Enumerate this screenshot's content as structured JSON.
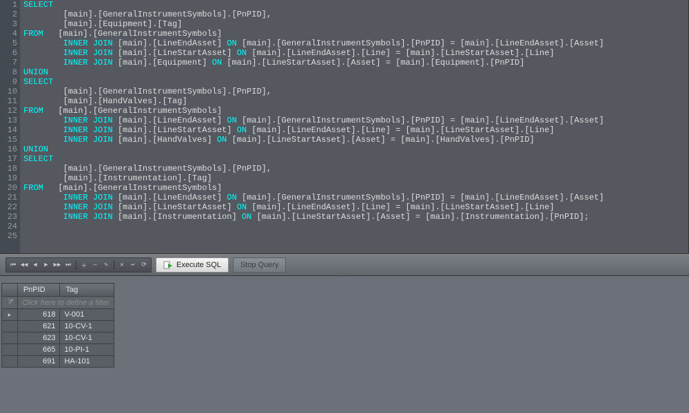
{
  "code_lines": [
    [
      {
        "t": "SELECT",
        "k": 1
      }
    ],
    [
      {
        "t": "        [main].[GeneralInstrumentSymbols].[PnPID],",
        "k": 0
      }
    ],
    [
      {
        "t": "        [main].[Equipment].[Tag]",
        "k": 0
      }
    ],
    [
      {
        "t": "FROM",
        "k": 1
      },
      {
        "t": "   [main].[GeneralInstrumentSymbols]",
        "k": 0
      }
    ],
    [
      {
        "t": "        ",
        "k": 0
      },
      {
        "t": "INNER JOIN",
        "k": 1
      },
      {
        "t": " [main].[LineEndAsset] ",
        "k": 0
      },
      {
        "t": "ON",
        "k": 1
      },
      {
        "t": " [main].[GeneralInstrumentSymbols].[PnPID] = [main].[LineEndAsset].[Asset]",
        "k": 0
      }
    ],
    [
      {
        "t": "        ",
        "k": 0
      },
      {
        "t": "INNER JOIN",
        "k": 1
      },
      {
        "t": " [main].[LineStartAsset] ",
        "k": 0
      },
      {
        "t": "ON",
        "k": 1
      },
      {
        "t": " [main].[LineEndAsset].[Line] = [main].[LineStartAsset].[Line]",
        "k": 0
      }
    ],
    [
      {
        "t": "        ",
        "k": 0
      },
      {
        "t": "INNER JOIN",
        "k": 1
      },
      {
        "t": " [main].[Equipment] ",
        "k": 0
      },
      {
        "t": "ON",
        "k": 1
      },
      {
        "t": " [main].[LineStartAsset].[Asset] = [main].[Equipment].[PnPID]",
        "k": 0
      }
    ],
    [
      {
        "t": "UNION",
        "k": 1
      }
    ],
    [
      {
        "t": "SELECT",
        "k": 1
      }
    ],
    [
      {
        "t": "        [main].[GeneralInstrumentSymbols].[PnPID],",
        "k": 0
      }
    ],
    [
      {
        "t": "        [main].[HandValves].[Tag]",
        "k": 0
      }
    ],
    [
      {
        "t": "FROM",
        "k": 1
      },
      {
        "t": "   [main].[GeneralInstrumentSymbols]",
        "k": 0
      }
    ],
    [
      {
        "t": "        ",
        "k": 0
      },
      {
        "t": "INNER JOIN",
        "k": 1
      },
      {
        "t": " [main].[LineEndAsset] ",
        "k": 0
      },
      {
        "t": "ON",
        "k": 1
      },
      {
        "t": " [main].[GeneralInstrumentSymbols].[PnPID] = [main].[LineEndAsset].[Asset]",
        "k": 0
      }
    ],
    [
      {
        "t": "        ",
        "k": 0
      },
      {
        "t": "INNER JOIN",
        "k": 1
      },
      {
        "t": " [main].[LineStartAsset] ",
        "k": 0
      },
      {
        "t": "ON",
        "k": 1
      },
      {
        "t": " [main].[LineEndAsset].[Line] = [main].[LineStartAsset].[Line]",
        "k": 0
      }
    ],
    [
      {
        "t": "        ",
        "k": 0
      },
      {
        "t": "INNER JOIN",
        "k": 1
      },
      {
        "t": " [main].[HandValves] ",
        "k": 0
      },
      {
        "t": "ON",
        "k": 1
      },
      {
        "t": " [main].[LineStartAsset].[Asset] = [main].[HandValves].[PnPID]",
        "k": 0
      }
    ],
    [
      {
        "t": "UNION",
        "k": 1
      }
    ],
    [
      {
        "t": "SELECT",
        "k": 1
      }
    ],
    [
      {
        "t": "        [main].[GeneralInstrumentSymbols].[PnPID],",
        "k": 0
      }
    ],
    [
      {
        "t": "        [main].[Instrumentation].[Tag]",
        "k": 0
      }
    ],
    [
      {
        "t": "FROM",
        "k": 1
      },
      {
        "t": "   [main].[GeneralInstrumentSymbols]",
        "k": 0
      }
    ],
    [
      {
        "t": "        ",
        "k": 0
      },
      {
        "t": "INNER JOIN",
        "k": 1
      },
      {
        "t": " [main].[LineEndAsset] ",
        "k": 0
      },
      {
        "t": "ON",
        "k": 1
      },
      {
        "t": " [main].[GeneralInstrumentSymbols].[PnPID] = [main].[LineEndAsset].[Asset]",
        "k": 0
      }
    ],
    [
      {
        "t": "        ",
        "k": 0
      },
      {
        "t": "INNER JOIN",
        "k": 1
      },
      {
        "t": " [main].[LineStartAsset] ",
        "k": 0
      },
      {
        "t": "ON",
        "k": 1
      },
      {
        "t": " [main].[LineEndAsset].[Line] = [main].[LineStartAsset].[Line]",
        "k": 0
      }
    ],
    [
      {
        "t": "        ",
        "k": 0
      },
      {
        "t": "INNER JOIN",
        "k": 1
      },
      {
        "t": " [main].[Instrumentation] ",
        "k": 0
      },
      {
        "t": "ON",
        "k": 1
      },
      {
        "t": " [main].[LineStartAsset].[Asset] = [main].[Instrumentation].[PnPID];",
        "k": 0
      }
    ],
    [
      {
        "t": "",
        "k": 0
      }
    ],
    [
      {
        "t": "",
        "k": 0
      }
    ]
  ],
  "buttons": {
    "execute": "Execute SQL",
    "stop": "Stop Query"
  },
  "nav_icons": [
    "⏮",
    "◀◀",
    "◀",
    "▶",
    "▶▶",
    "⏭",
    "＋",
    "—",
    "✎",
    "✕",
    "↩",
    "⟳"
  ],
  "results": {
    "columns": [
      "PnPID",
      "Tag"
    ],
    "filter_placeholder": "Click here to define a filter",
    "rows": [
      {
        "PnPID": "618",
        "Tag": "V-001",
        "sel": true
      },
      {
        "PnPID": "621",
        "Tag": "10-CV-1"
      },
      {
        "PnPID": "623",
        "Tag": "10-CV-1"
      },
      {
        "PnPID": "665",
        "Tag": "10-PI-1"
      },
      {
        "PnPID": "691",
        "Tag": "HA-101"
      }
    ]
  }
}
